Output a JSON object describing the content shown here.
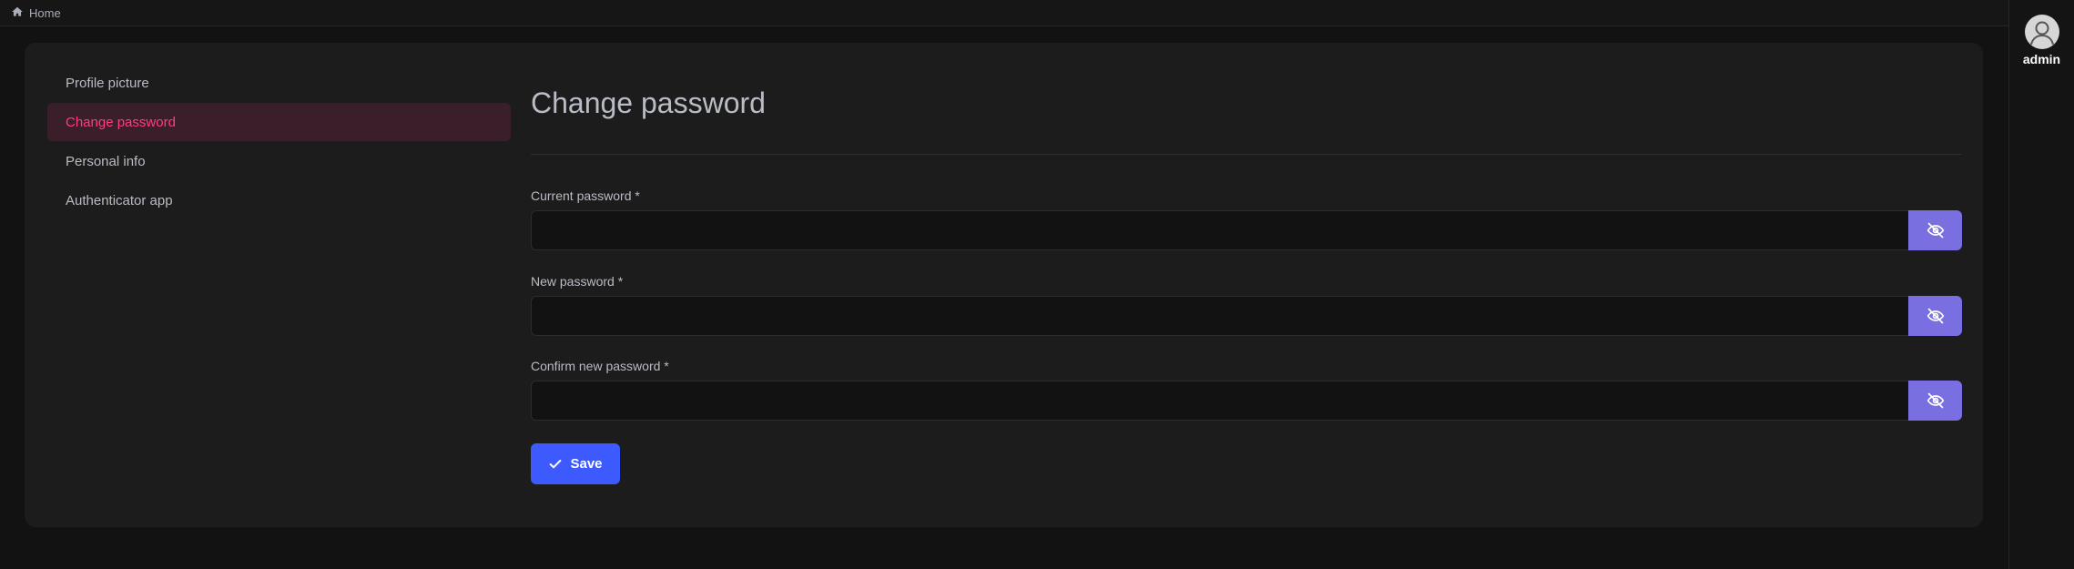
{
  "breadcrumb": {
    "home_label": "Home"
  },
  "user": {
    "name": "admin"
  },
  "sidebar": {
    "items": [
      {
        "label": "Profile picture",
        "active": false
      },
      {
        "label": "Change password",
        "active": true
      },
      {
        "label": "Personal info",
        "active": false
      },
      {
        "label": "Authenticator app",
        "active": false
      }
    ]
  },
  "form": {
    "title": "Change password",
    "fields": [
      {
        "label": "Current password *",
        "value": ""
      },
      {
        "label": "New password *",
        "value": ""
      },
      {
        "label": "Confirm new password *",
        "value": ""
      }
    ],
    "save_label": "Save"
  },
  "colors": {
    "accent_pink": "#ff3d7f",
    "eye_button": "#7a6fe0",
    "save_button": "#3d5afe"
  },
  "icons": {
    "home": "home-icon",
    "avatar": "user-avatar-icon",
    "eye": "eye-slash-icon",
    "save": "check-icon"
  }
}
